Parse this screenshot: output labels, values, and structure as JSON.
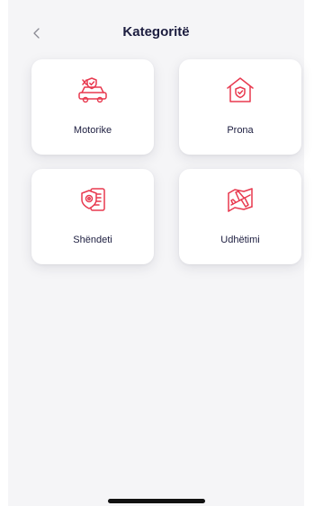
{
  "header": {
    "title": "Kategoritë",
    "back_icon": "chevron-left-icon"
  },
  "categories": [
    {
      "label": "Motorike",
      "icon": "car-insurance-icon"
    },
    {
      "label": "Prona",
      "icon": "house-shield-icon"
    },
    {
      "label": "Shëndeti",
      "icon": "health-document-icon"
    },
    {
      "label": "Udhëtimi",
      "icon": "travel-airplane-icon"
    }
  ],
  "colors": {
    "accent": "#e8394f",
    "title": "#1c1d3f",
    "background": "#f5f5f7",
    "card": "#ffffff"
  }
}
